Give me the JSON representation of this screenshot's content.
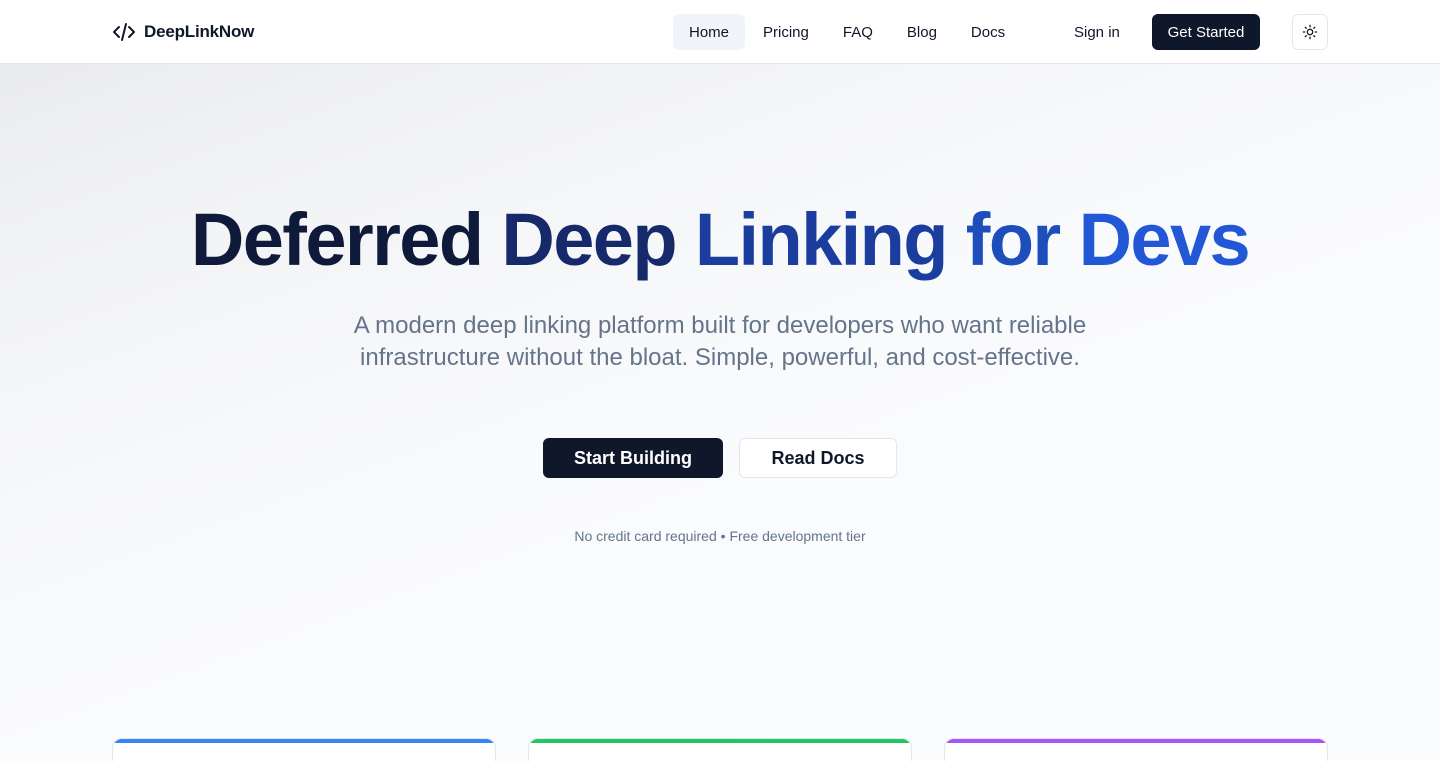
{
  "brand": {
    "name": "DeepLinkNow",
    "icon": "code-icon"
  },
  "nav": {
    "items": [
      {
        "label": "Home",
        "active": true
      },
      {
        "label": "Pricing",
        "active": false
      },
      {
        "label": "FAQ",
        "active": false
      },
      {
        "label": "Blog",
        "active": false
      },
      {
        "label": "Docs",
        "active": false
      }
    ],
    "sign_in": "Sign in",
    "get_started": "Get Started",
    "theme_toggle_icon": "sun-icon"
  },
  "hero": {
    "title_words": [
      "Deferred",
      "Deep",
      "Linking",
      "for",
      "Devs"
    ],
    "subtitle": "A modern deep linking platform built for developers who want reliable infrastructure without the bloat. Simple, powerful, and cost-effective.",
    "primary_cta": "Start Building",
    "secondary_cta": "Read Docs",
    "note": "No credit card required • Free development tier"
  },
  "feature_cards": [
    {
      "accent": "#3b82f6"
    },
    {
      "accent": "#22c55e"
    },
    {
      "accent": "#a855f7"
    }
  ],
  "colors": {
    "primary_dark": "#0f172a",
    "title_gradient": [
      "#0f1a3a",
      "#15296b",
      "#1a3d9e",
      "#1d4ebb",
      "#2257d6"
    ],
    "muted_text": "#64748b"
  }
}
